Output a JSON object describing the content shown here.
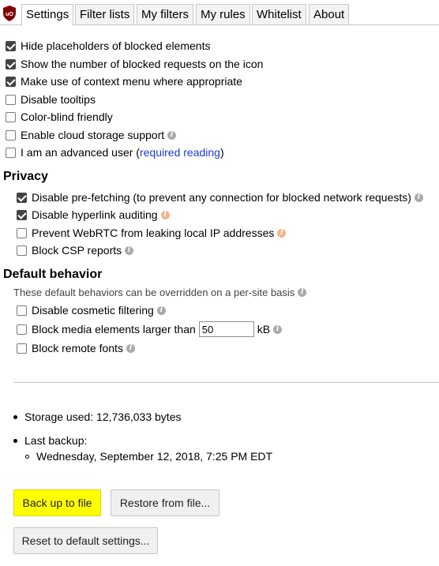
{
  "tabs": [
    {
      "label": "Settings",
      "active": true
    },
    {
      "label": "Filter lists",
      "active": false
    },
    {
      "label": "My filters",
      "active": false
    },
    {
      "label": "My rules",
      "active": false
    },
    {
      "label": "Whitelist",
      "active": false
    },
    {
      "label": "About",
      "active": false
    }
  ],
  "general": {
    "hide_placeholders": {
      "label": "Hide placeholders of blocked elements",
      "checked": true
    },
    "show_count": {
      "label": "Show the number of blocked requests on the icon",
      "checked": true
    },
    "context_menu": {
      "label": "Make use of context menu where appropriate",
      "checked": true
    },
    "disable_tooltips": {
      "label": "Disable tooltips",
      "checked": false
    },
    "color_blind": {
      "label": "Color-blind friendly",
      "checked": false
    },
    "cloud_storage": {
      "label": "Enable cloud storage support",
      "checked": false
    },
    "advanced_user": {
      "label": "I am an advanced user (",
      "link": "required reading",
      "suffix": ")",
      "checked": false
    }
  },
  "privacy": {
    "heading": "Privacy",
    "prefetching": {
      "label": "Disable pre-fetching (to prevent any connection for blocked network requests)",
      "checked": true
    },
    "hyperlink_auditing": {
      "label": "Disable hyperlink auditing",
      "checked": true
    },
    "webrtc": {
      "label": "Prevent WebRTC from leaking local IP addresses",
      "checked": false
    },
    "csp_reports": {
      "label": "Block CSP reports",
      "checked": false
    }
  },
  "default_behavior": {
    "heading": "Default behavior",
    "note": "These default behaviors can be overridden on a per-site basis",
    "cosmetic": {
      "label": "Disable cosmetic filtering",
      "checked": false
    },
    "media": {
      "label": "Block media elements larger than",
      "value": "50",
      "unit": "kB",
      "checked": false
    },
    "remote_fonts": {
      "label": "Block remote fonts",
      "checked": false
    }
  },
  "storage": {
    "used": "Storage used: 12,736,033 bytes",
    "last_backup_label": "Last backup:",
    "last_backup_date": "Wednesday, September 12, 2018, 7:25 PM EDT"
  },
  "buttons": {
    "backup": "Back up to file",
    "restore": "Restore from file...",
    "reset": "Reset to default settings..."
  },
  "colors": {
    "link": "#1a3bd3",
    "highlight": "#ffff00",
    "logo": "#800000"
  },
  "icons": {
    "logo": "ublock-shield-icon",
    "info": "info-icon"
  }
}
